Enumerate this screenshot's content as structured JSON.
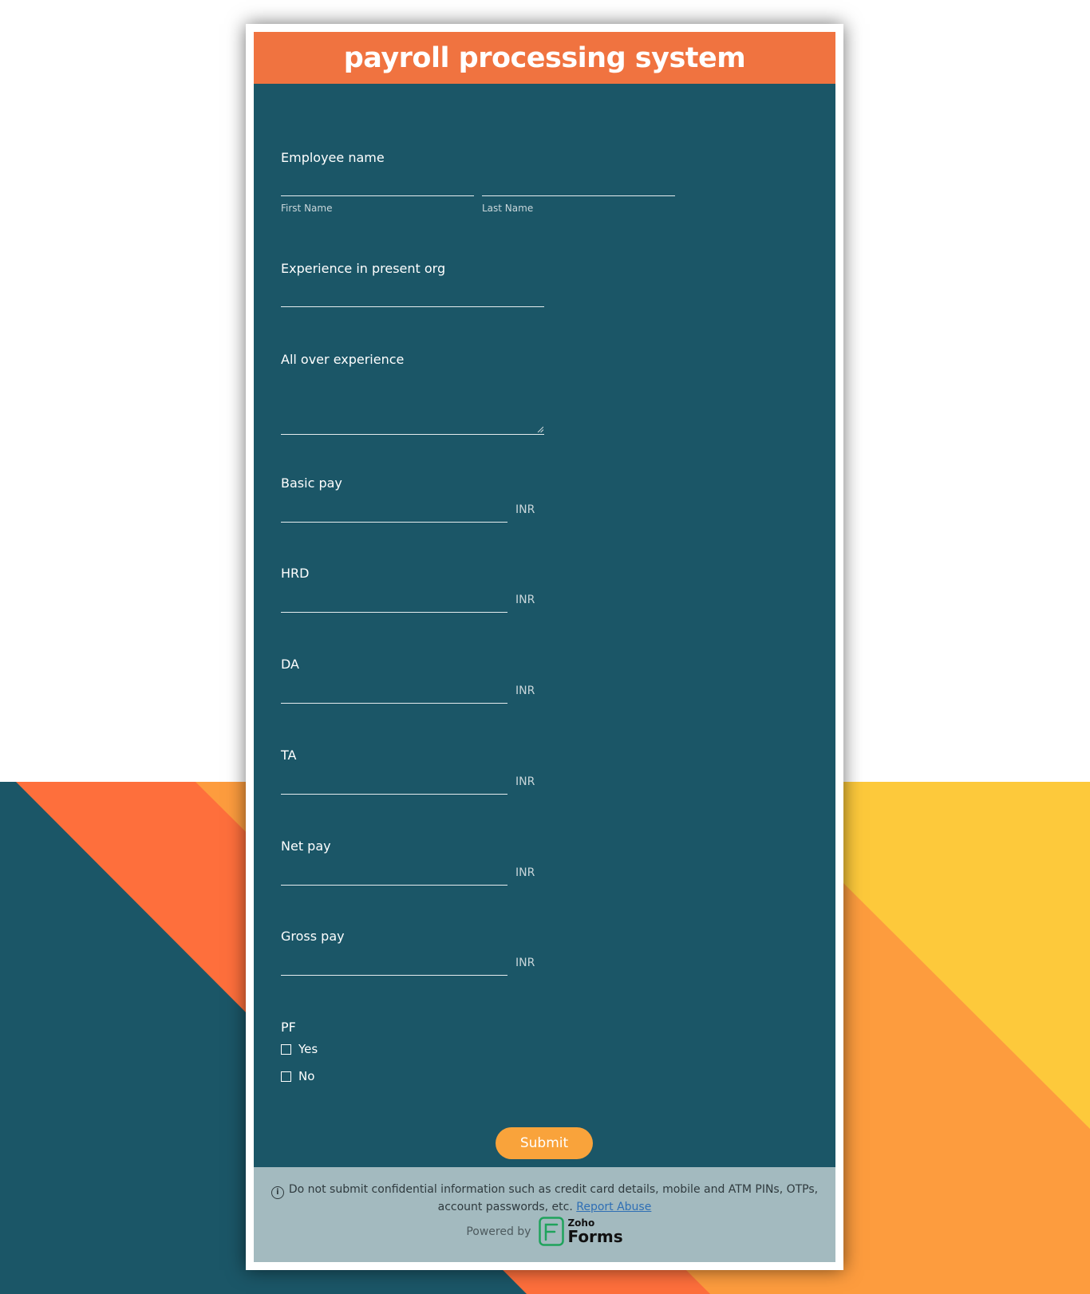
{
  "form": {
    "title": "payroll processing system",
    "employee_name": {
      "label": "Employee name",
      "first_name_label": "First Name",
      "last_name_label": "Last Name",
      "first_name_value": "",
      "last_name_value": ""
    },
    "experience_present": {
      "label": "Experience in present org",
      "value": ""
    },
    "all_over_experience": {
      "label": "All over experience",
      "value": ""
    },
    "currency_fields": [
      {
        "label": "Basic pay",
        "unit": "INR",
        "value": ""
      },
      {
        "label": "HRD",
        "unit": "INR",
        "value": ""
      },
      {
        "label": "DA",
        "unit": "INR",
        "value": ""
      },
      {
        "label": "TA",
        "unit": "INR",
        "value": ""
      },
      {
        "label": "Net pay",
        "unit": "INR",
        "value": ""
      },
      {
        "label": "Gross pay",
        "unit": "INR",
        "value": ""
      }
    ],
    "pf": {
      "label": "PF",
      "options": [
        {
          "label": "Yes",
          "checked": false
        },
        {
          "label": "No",
          "checked": false
        }
      ]
    },
    "submit_label": "Submit"
  },
  "footer": {
    "notice": "Do not submit confidential information such as credit card details, mobile and ATM PINs, OTPs, account passwords, etc.",
    "report_link": "Report Abuse",
    "powered_by": "Powered by",
    "logo_top": "Zoho",
    "logo_bottom": "Forms"
  },
  "colors": {
    "header": "#f07340",
    "form_body": "#1b5667",
    "submit": "#f9a33b",
    "footer": "#a3babf",
    "bg_teal": "#1b5667",
    "bg_orange": "#fe6f3c",
    "bg_light_orange": "#fd9c3e",
    "bg_yellow": "#fdc93b",
    "logo_green": "#1fa35c"
  },
  "icons": {
    "info": "info-icon",
    "resize": "resize-grip-icon",
    "logo": "zoho-forms-logo-icon"
  }
}
